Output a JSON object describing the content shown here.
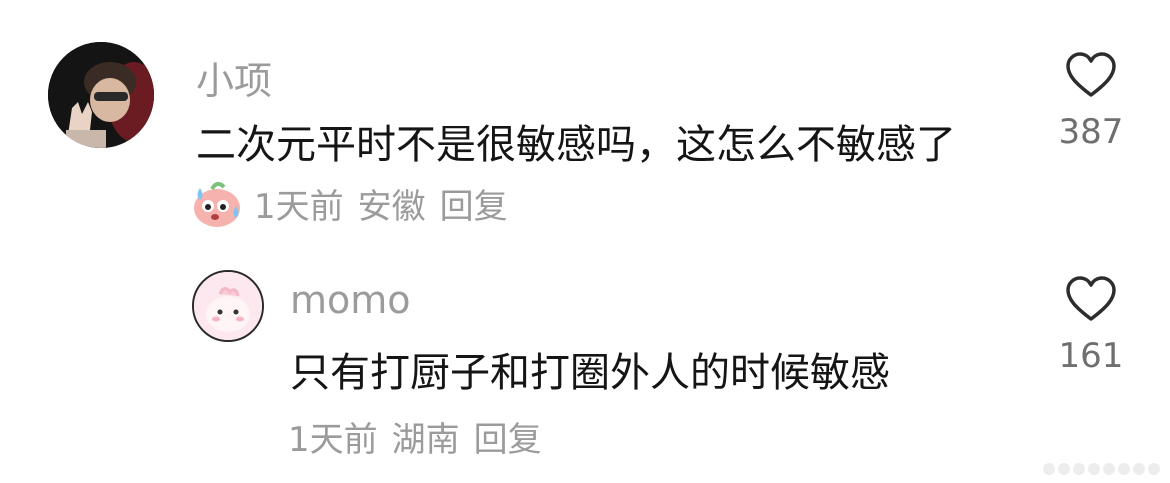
{
  "comments": [
    {
      "username": "小项",
      "text": "二次元平时不是很敏感吗，这怎么不敏感了",
      "likes": "387",
      "time": "1天前",
      "location": "安徽",
      "reply_label": "回复",
      "sticker": "sweating-face-sticker"
    }
  ],
  "replies": [
    {
      "username": "momo",
      "text": "只有打厨子和打圈外人的时候敏感",
      "likes": "161",
      "time": "1天前",
      "location": "湖南",
      "reply_label": "回复"
    }
  ],
  "icons": {
    "like": "heart-outline-icon"
  },
  "colors": {
    "meta_text": "#9b9b9b",
    "body_text": "#151515",
    "sticker_pink": "#f4a6a6"
  }
}
